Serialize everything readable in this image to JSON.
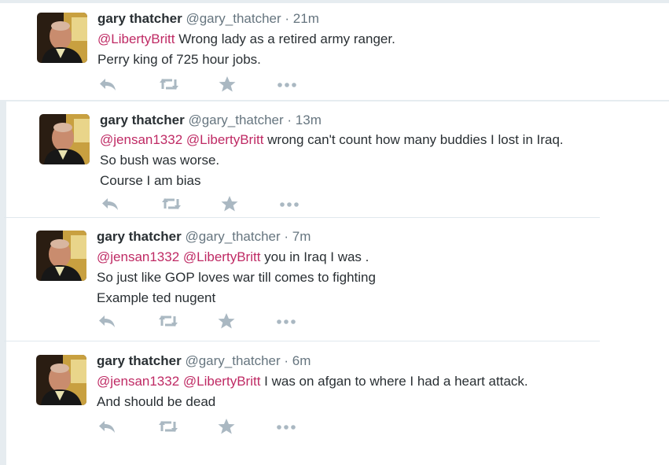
{
  "colors": {
    "mention": "#bf2a64",
    "action_icon": "#aab8c2",
    "background": "#e6ecf0"
  },
  "tweets": [
    {
      "name": "gary thatcher",
      "handle": "@gary_thatcher",
      "sep": "·",
      "time": "21m",
      "lines": [
        [
          {
            "t": "@LibertyBritt",
            "m": true
          },
          {
            "t": " Wrong lady as a retired army ranger.",
            "m": false
          }
        ],
        [
          {
            "t": "Perry king of 725 hour jobs.",
            "m": false
          }
        ]
      ],
      "actions": [
        "reply-icon",
        "retweet-icon",
        "favorite-icon",
        "more-icon"
      ]
    },
    {
      "name": "gary thatcher",
      "handle": "@gary_thatcher",
      "sep": "·",
      "time": "13m",
      "lines": [
        [
          {
            "t": "@jensan1332",
            "m": true
          },
          {
            "t": " ",
            "m": false
          },
          {
            "t": "@LibertyBritt",
            "m": true
          },
          {
            "t": " wrong can't count how many buddies I lost in Iraq.",
            "m": false
          }
        ],
        [
          {
            "t": "So bush was worse.",
            "m": false
          }
        ],
        [
          {
            "t": "Course I am bias",
            "m": false
          }
        ]
      ],
      "actions": [
        "reply-icon",
        "retweet-icon",
        "favorite-icon",
        "more-icon"
      ]
    },
    {
      "name": "gary thatcher",
      "handle": "@gary_thatcher",
      "sep": "·",
      "time": "7m",
      "lines": [
        [
          {
            "t": "@jensan1332",
            "m": true
          },
          {
            "t": " ",
            "m": false
          },
          {
            "t": "@LibertyBritt",
            "m": true
          },
          {
            "t": " you in Iraq I was .",
            "m": false
          }
        ],
        [
          {
            "t": "So just like GOP loves war till comes to fighting",
            "m": false
          }
        ],
        [
          {
            "t": "Example ted nugent",
            "m": false
          }
        ]
      ],
      "actions": [
        "reply-icon",
        "retweet-icon",
        "favorite-icon",
        "more-icon"
      ]
    },
    {
      "name": "gary thatcher",
      "handle": "@gary_thatcher",
      "sep": "·",
      "time": "6m",
      "lines": [
        [
          {
            "t": "@jensan1332",
            "m": true
          },
          {
            "t": " ",
            "m": false
          },
          {
            "t": "@LibertyBritt",
            "m": true
          },
          {
            "t": " I was on afgan to where I had a heart attack.",
            "m": false
          }
        ],
        [
          {
            "t": "And should be dead",
            "m": false
          }
        ]
      ],
      "actions": [
        "reply-icon",
        "retweet-icon",
        "favorite-icon",
        "more-icon"
      ]
    }
  ]
}
